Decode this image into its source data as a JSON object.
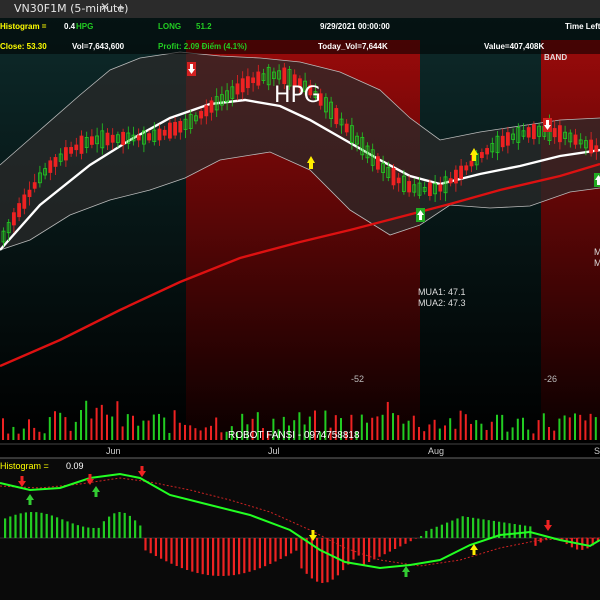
{
  "window": {
    "tab_title": "VN30F1M (5-minute)",
    "add_tab_label": "+",
    "close_label": "✕"
  },
  "main_panel": {
    "header": {
      "histogram_label": "Histogram =",
      "histogram_value": "0.4",
      "symbol": "HPG",
      "long_label": "LONG",
      "long_value": "51.2",
      "datetime": "9/29/2021 00:00:00",
      "time_left_label": "Time Left",
      "close_label": "Close: 53.30",
      "vol_label": "Vol=7,643,600",
      "profit_label": "Profit: 2.09 Điểm  (4.1%)",
      "today_vol_label": "Today_Vol=7,644K",
      "value_label": "Value=407,408K",
      "band_label": "BAND"
    },
    "watermark_symbol": "HPG",
    "annotations": {
      "mua1": "MUA1: 47.1",
      "mua2": "MUA2: 47.3",
      "count_1": "-52",
      "count_2": "-26",
      "right_m1": "M",
      "right_m2": "M"
    },
    "footer_label": "ROBOT FANSI - 0974758818",
    "x_axis_labels": [
      "Jun",
      "Jul",
      "Aug",
      "S"
    ]
  },
  "histogram_panel": {
    "label": "Histogram =",
    "value": "0.09"
  },
  "colors": {
    "background": "#000000",
    "bull_candle": "#22cc22",
    "bear_candle": "#ee2222",
    "short_zone": "#8b0000",
    "upper_band": "#bbbbbb",
    "middle_band": "#ffffff",
    "long_ma": "#dd1111",
    "buy_arrow": "#33cc33",
    "sell_arrow": "#ee2222",
    "signal_yellow": "#ffee00",
    "macd_line": "#22ff22",
    "signal_line": "#cc2222",
    "header_yellow": "#ffff00",
    "header_green": "#22cc22"
  },
  "icons": {
    "buy_signal": "up-arrow-icon",
    "sell_signal": "down-arrow-icon",
    "hold_signal": "yellow-arrow-icon"
  }
}
